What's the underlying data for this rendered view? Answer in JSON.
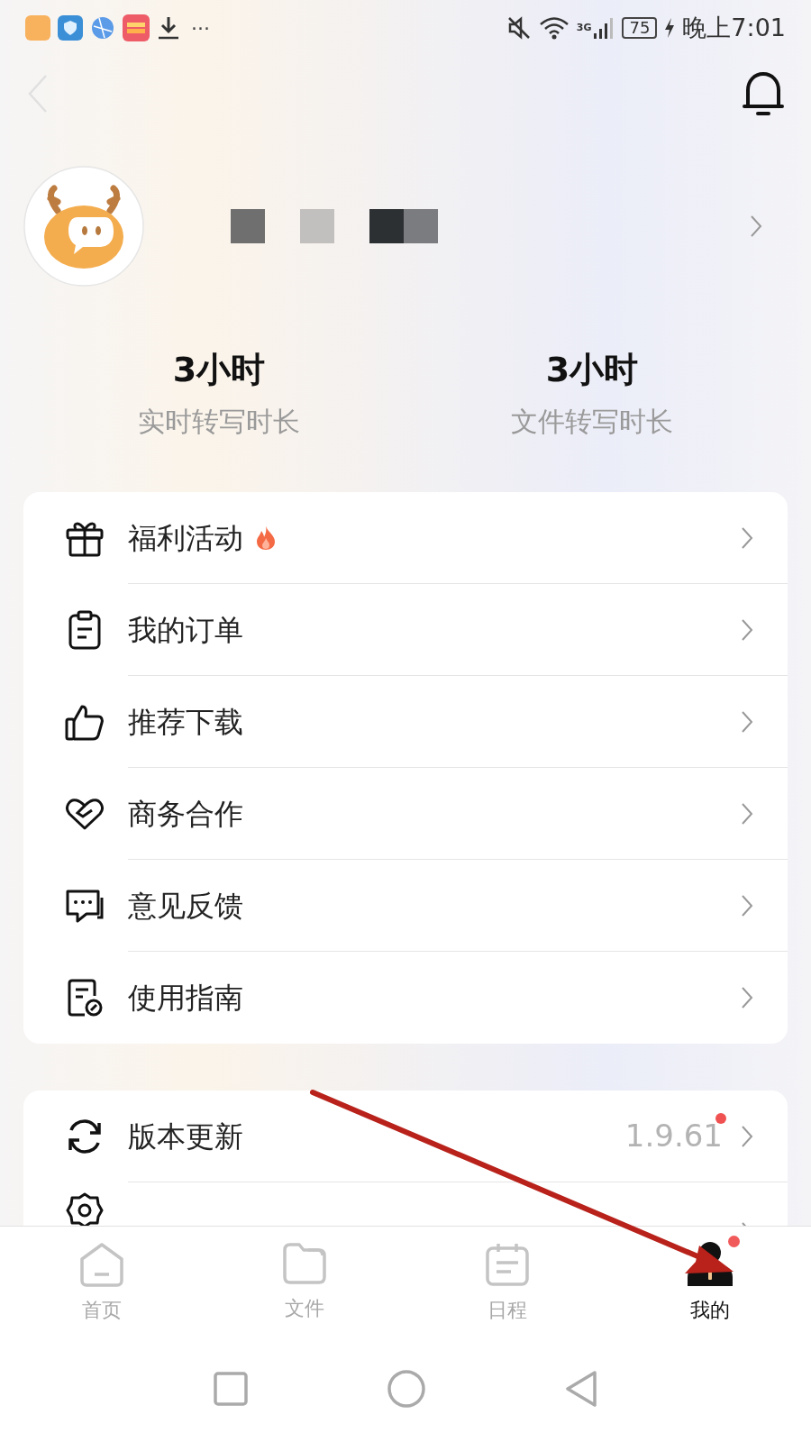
{
  "status_bar": {
    "more": "···",
    "network": "3G",
    "battery": "75",
    "time": "晚上7:01"
  },
  "stats": [
    {
      "value": "3小时",
      "label": "实时转写时长"
    },
    {
      "value": "3小时",
      "label": "文件转写时长"
    }
  ],
  "menu_groups": [
    [
      {
        "label": "福利活动",
        "hot": true
      },
      {
        "label": "我的订单",
        "hot": false
      },
      {
        "label": "推荐下载",
        "hot": false
      },
      {
        "label": "商务合作",
        "hot": false
      },
      {
        "label": "意见反馈",
        "hot": false
      },
      {
        "label": "使用指南",
        "hot": false
      }
    ],
    [
      {
        "label": "版本更新",
        "hot": false,
        "value": "1.9.61",
        "new_dot": true
      },
      {
        "kind": "cut_off"
      }
    ]
  ],
  "tabs": [
    {
      "label": "首页",
      "selected": false,
      "dot": false
    },
    {
      "label": "文件",
      "selected": false,
      "dot": false
    },
    {
      "label": "日程",
      "selected": false,
      "dot": false
    },
    {
      "label": "我的",
      "selected": true,
      "dot": true
    }
  ]
}
